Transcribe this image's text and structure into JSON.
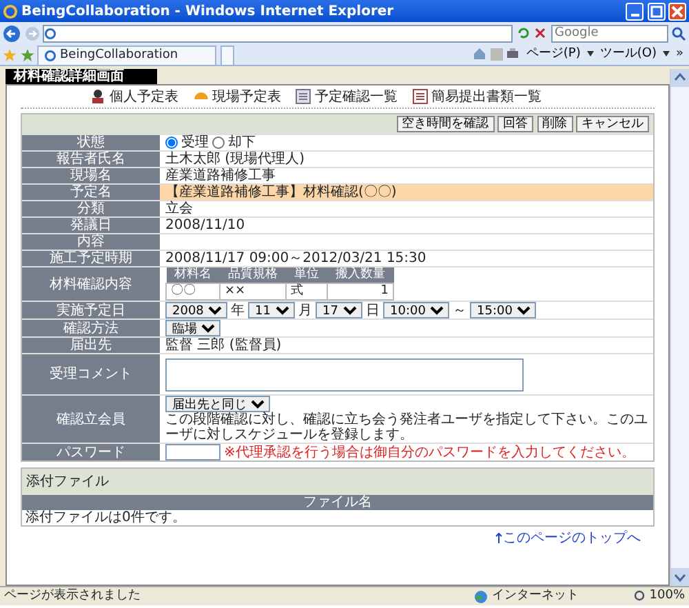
{
  "window": {
    "title": "BeingCollaboration - Windows Internet Explorer"
  },
  "browser": {
    "search_placeholder": "Google",
    "tab": "BeingCollaboration",
    "menus": [
      "ページ(P)",
      "ツール(O)"
    ],
    "overflow": "»"
  },
  "page_tab": "材料確認詳細画面",
  "nav": [
    {
      "label": "個人予定表",
      "kind": "person"
    },
    {
      "label": "現場予定表",
      "kind": "helmet"
    },
    {
      "label": "予定確認一覧",
      "kind": "list"
    },
    {
      "label": "簡易提出書類一覧",
      "kind": "doc"
    }
  ],
  "buttons": [
    "空き時間を確認",
    "回答",
    "削除",
    "キャンセル"
  ],
  "fields": [
    {
      "label": "状態",
      "kind": "radio",
      "options": [
        {
          "label": "受理",
          "selected": true
        },
        {
          "label": "却下",
          "selected": false
        }
      ]
    },
    {
      "label": "報告者氏名",
      "kind": "text",
      "value": "土木太郎 (現場代理人)"
    },
    {
      "label": "現場名",
      "kind": "text",
      "value": "産業道路補修工事"
    },
    {
      "label": "予定名",
      "kind": "text",
      "value": "【産業道路補修工事】材料確認(〇〇)",
      "highlighted": true
    },
    {
      "label": "分類",
      "kind": "text",
      "value": "立会"
    },
    {
      "label": "発議日",
      "kind": "text",
      "value": "2008/11/10"
    },
    {
      "label": "内容",
      "kind": "text"
    },
    {
      "label": "施工予定時期",
      "kind": "text",
      "value": "2008/11/17 09:00～2012/03/21 15:30"
    },
    {
      "label": "材料確認内容",
      "kind": "table",
      "columns": [
        "材料名",
        "品質規格",
        "単位",
        "搬入数量"
      ],
      "rows": [
        [
          "〇〇",
          "××",
          "式",
          "1"
        ]
      ]
    },
    {
      "label": "実施予定日",
      "kind": "date",
      "parts": [
        {
          "value": "2008",
          "unit": "年"
        },
        {
          "value": "11",
          "unit": "月"
        },
        {
          "value": "17",
          "unit": "日"
        },
        {
          "value": "10:00",
          "unit": "～"
        },
        {
          "value": "15:00"
        }
      ]
    },
    {
      "label": "確認方法",
      "kind": "select",
      "value": "臨場"
    },
    {
      "label": "届出先",
      "kind": "text",
      "value": "監督 三郎 (監督員)"
    },
    {
      "label": "受理コメント",
      "kind": "textarea"
    },
    {
      "label": "確認立会員",
      "kind": "select",
      "value": "届出先と同じ",
      "note": "この段階確認に対し、確認に立ち会う発注者ユーザを指定して下さい。このユーザに対しスケジュールを登録します。"
    },
    {
      "label": "パスワード",
      "kind": "password",
      "note": "※代理承認を行う場合は御自分のパスワードを入力してください。"
    }
  ],
  "attachments": {
    "title": "添付ファイル",
    "column": "ファイル名",
    "empty_text": "添付ファイルは0件です。"
  },
  "top_link": "このページのトップへ",
  "status_bar": {
    "message": "ページが表示されました",
    "zone": "インターネット",
    "zoom": "100%"
  }
}
